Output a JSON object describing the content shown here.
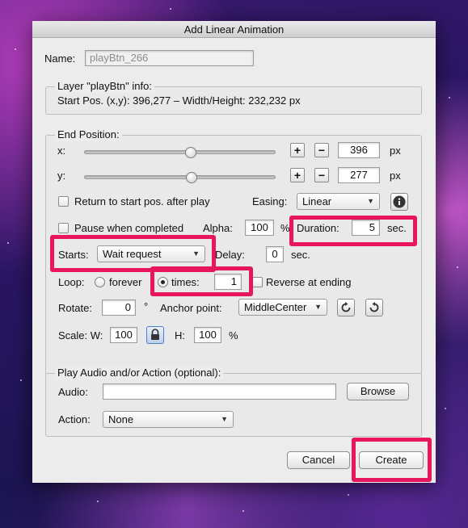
{
  "dialog": {
    "title": "Add Linear Animation"
  },
  "name": {
    "label": "Name:",
    "value": "playBtn_266"
  },
  "layer_info": {
    "legend": "Layer \"playBtn\" info:",
    "text": "Start Pos. (x,y): 396,277 – Width/Height: 232,232 px"
  },
  "end_position": {
    "legend": "End Position:",
    "x": {
      "label": "x:",
      "value": "396",
      "unit": "px",
      "plus": "+",
      "minus": "−"
    },
    "y": {
      "label": "y:",
      "value": "277",
      "unit": "px",
      "plus": "+",
      "minus": "−"
    },
    "return_label": "Return to start pos. after play",
    "easing": {
      "label": "Easing:",
      "value": "Linear"
    },
    "pause_label": "Pause when completed",
    "alpha": {
      "label": "Alpha:",
      "value": "100",
      "unit": "%"
    },
    "duration": {
      "label": "Duration:",
      "value": "5",
      "unit": "sec."
    },
    "starts": {
      "label": "Starts:",
      "value": "Wait request"
    },
    "delay": {
      "label": "Delay:",
      "value": "0",
      "unit": "sec."
    },
    "loop": {
      "label": "Loop:",
      "forever_label": "forever",
      "times_label": "times:",
      "times_value": "1",
      "reverse_label": "Reverse at ending"
    },
    "rotate": {
      "label": "Rotate:",
      "value": "0",
      "unit": "°"
    },
    "anchor": {
      "label": "Anchor point:",
      "value": "MiddleCenter"
    },
    "scale": {
      "label_w": "Scale: W:",
      "w_value": "100",
      "label_h": "H:",
      "h_value": "100",
      "unit": "%"
    }
  },
  "audio_section": {
    "legend": "Play Audio and/or Action (optional):",
    "audio_label": "Audio:",
    "audio_value": "",
    "browse_label": "Browse",
    "action_label": "Action:",
    "action_value": "None"
  },
  "buttons": {
    "cancel": "Cancel",
    "create": "Create"
  },
  "highlight_color": "#e8175d"
}
